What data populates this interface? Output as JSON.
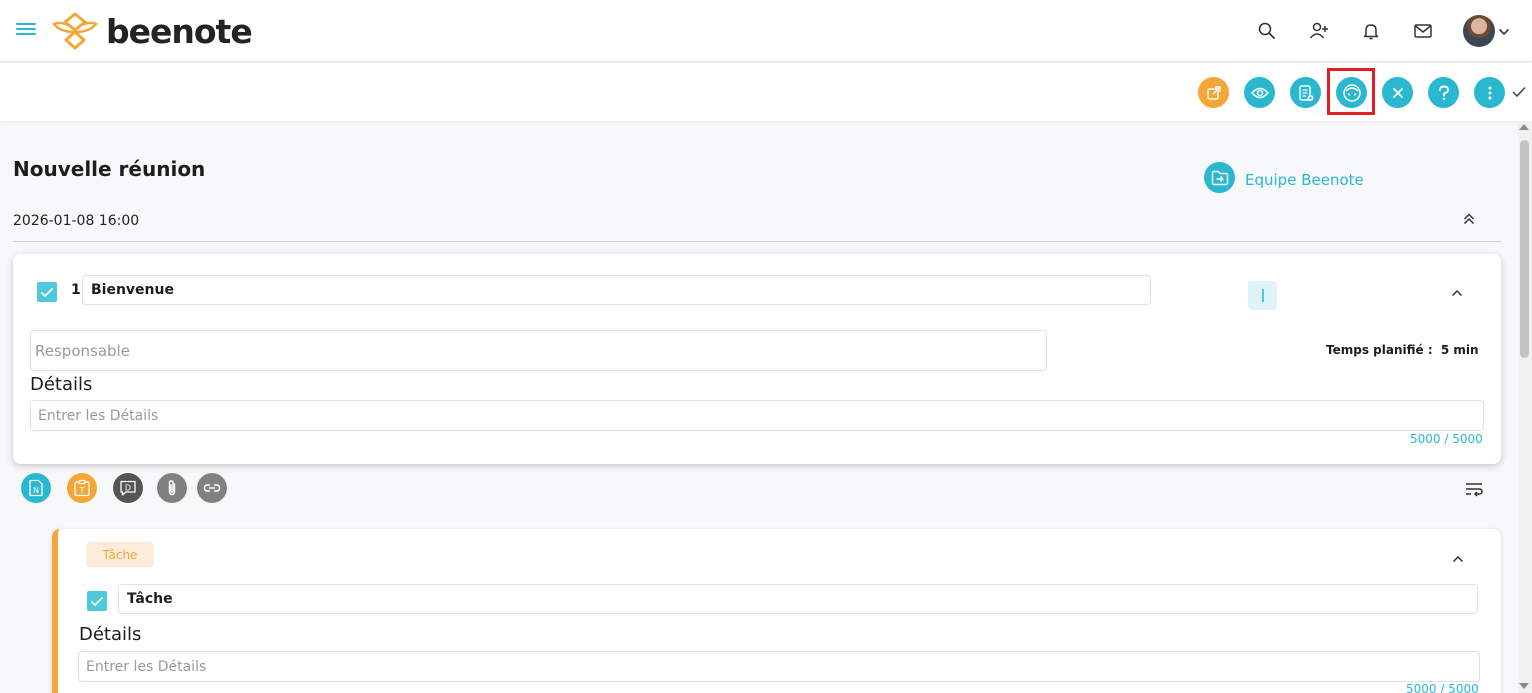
{
  "app": {
    "brand": "beenote"
  },
  "meeting": {
    "title": "Nouvelle réunion",
    "datetime": "2026-01-08 16:00",
    "team_label": "Equipe Beenote"
  },
  "agenda_item": {
    "number": "1.",
    "title": "Bienvenue",
    "responsable_placeholder": "Responsable",
    "planned_time_label": "Temps planifié :",
    "planned_time_value": "5 min",
    "details_label": "Détails",
    "details_placeholder": "Entrer les Détails",
    "char_counter": "5000 / 5000"
  },
  "task": {
    "chip_label": "Tâche",
    "title": "Tâche",
    "details_label": "Détails",
    "details_placeholder": "Entrer les Détails",
    "char_counter": "5000 / 5000"
  },
  "attachments": {
    "note_letter": "N",
    "task_letter": "T",
    "decision_letter": "D"
  },
  "colors": {
    "primary": "#2ab7d0",
    "accent": "#f4a637",
    "highlight": "#e21f26"
  },
  "icons": [
    "menu-icon",
    "bee-logo-icon",
    "search-icon",
    "add-user-icon",
    "bell-icon",
    "mail-icon",
    "chevron-down-icon",
    "share-icon",
    "eye-icon",
    "clipboard-icon",
    "face-icon",
    "close-icon",
    "help-icon",
    "more-vertical-icon",
    "check-icon",
    "folder-arrow-icon",
    "double-chevron-up-icon",
    "chevron-up-icon",
    "note-icon",
    "task-icon",
    "decision-icon",
    "paperclip-icon",
    "link-icon",
    "wrap-text-icon"
  ]
}
